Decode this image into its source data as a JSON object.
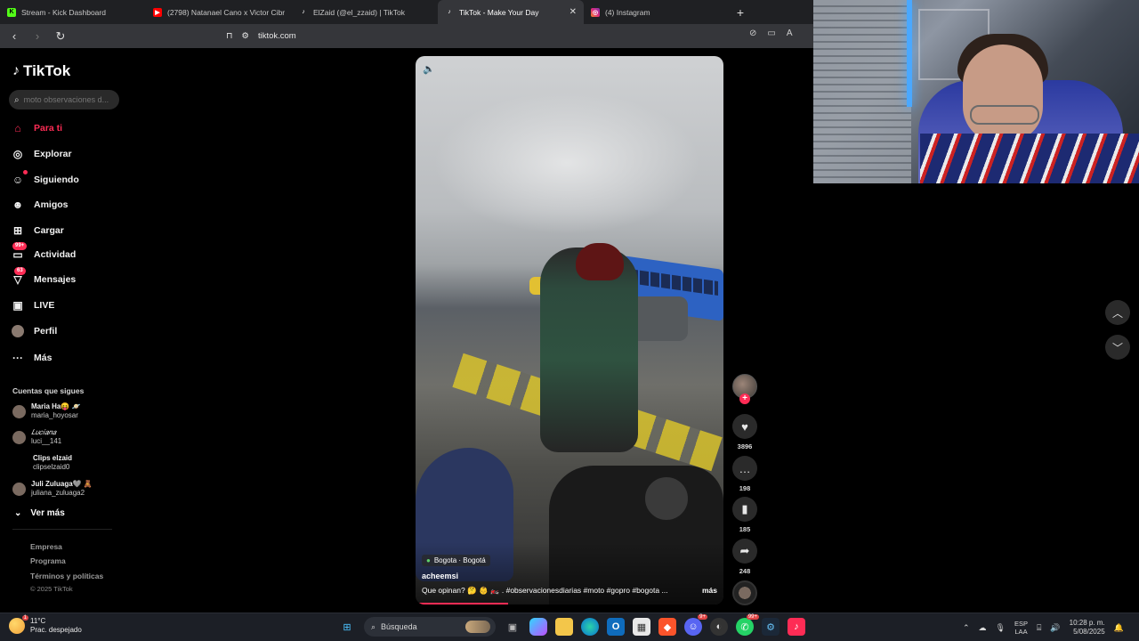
{
  "browser": {
    "tabs": [
      {
        "title": "Stream - Kick Dashboard",
        "icon": "kick-icon",
        "color": "#53fc18",
        "active": false
      },
      {
        "title": "(2798) Natanael Cano x Victor Cibrian",
        "icon": "youtube-icon",
        "color": "#ff0000",
        "active": false
      },
      {
        "title": "ElZaid (@el_zzaid) | TikTok",
        "icon": "tiktok-icon",
        "color": "#ffffff",
        "active": false
      },
      {
        "title": "TikTok - Make Your Day",
        "icon": "tiktok-icon",
        "color": "#ffffff",
        "active": true
      },
      {
        "title": "(4) Instagram",
        "icon": "instagram-icon",
        "color": "#e1306c",
        "active": false
      }
    ],
    "new_tab": "+",
    "url": "tiktok.com"
  },
  "sidebar": {
    "logo": "TikTok",
    "search_placeholder": "moto observaciones d...",
    "nav": [
      {
        "label": "Para ti",
        "icon": "home-icon",
        "active": true
      },
      {
        "label": "Explorar",
        "icon": "compass-icon"
      },
      {
        "label": "Siguiendo",
        "icon": "following-icon"
      },
      {
        "label": "Amigos",
        "icon": "friends-icon"
      },
      {
        "label": "Cargar",
        "icon": "upload-icon"
      },
      {
        "label": "Actividad",
        "icon": "activity-icon",
        "badge": "99+"
      },
      {
        "label": "Mensajes",
        "icon": "messages-icon",
        "badge": "63"
      },
      {
        "label": "LIVE",
        "icon": "live-icon"
      },
      {
        "label": "Perfil",
        "icon": "profile-icon"
      },
      {
        "label": "Más",
        "icon": "more-icon"
      }
    ],
    "following_title": "Cuentas que sigues",
    "following": [
      {
        "name": "Maria Ha😝 🪐",
        "handle": "maria_hoyosar"
      },
      {
        "name": "𝐿𝑢𝑐𝑖𝑎𝑛𝑎",
        "handle": "luci__141"
      },
      {
        "name": "Clips elzaid",
        "handle": "clipselzaid0"
      },
      {
        "name": "Juli Zuluaga🩶 🧸",
        "handle": "juliana_zuluaga2"
      }
    ],
    "see_more": "Ver más",
    "footer": [
      "Empresa",
      "Programa",
      "Términos y políticas"
    ],
    "copyright": "© 2025 TikTok"
  },
  "video": {
    "location": "Bogota · Bogotá",
    "author": "acheemsi",
    "caption": "Que opinan? 🤔 👶 🏍️ . #observacionesdiarias #moto #gopro #bogota ...",
    "more": "más",
    "progress": 0.3
  },
  "actions": {
    "likes": "3896",
    "comments": "198",
    "saves": "185",
    "shares": "248"
  },
  "taskbar": {
    "weather_temp": "11°C",
    "weather_desc": "Prac. despejado",
    "search_placeholder": "Búsqueda",
    "lang_1": "ESP",
    "lang_2": "LAA",
    "time": "10:28 p. m.",
    "date": "5/08/2025",
    "badges": {
      "discord": "9+",
      "whatsapp": "99+"
    }
  }
}
